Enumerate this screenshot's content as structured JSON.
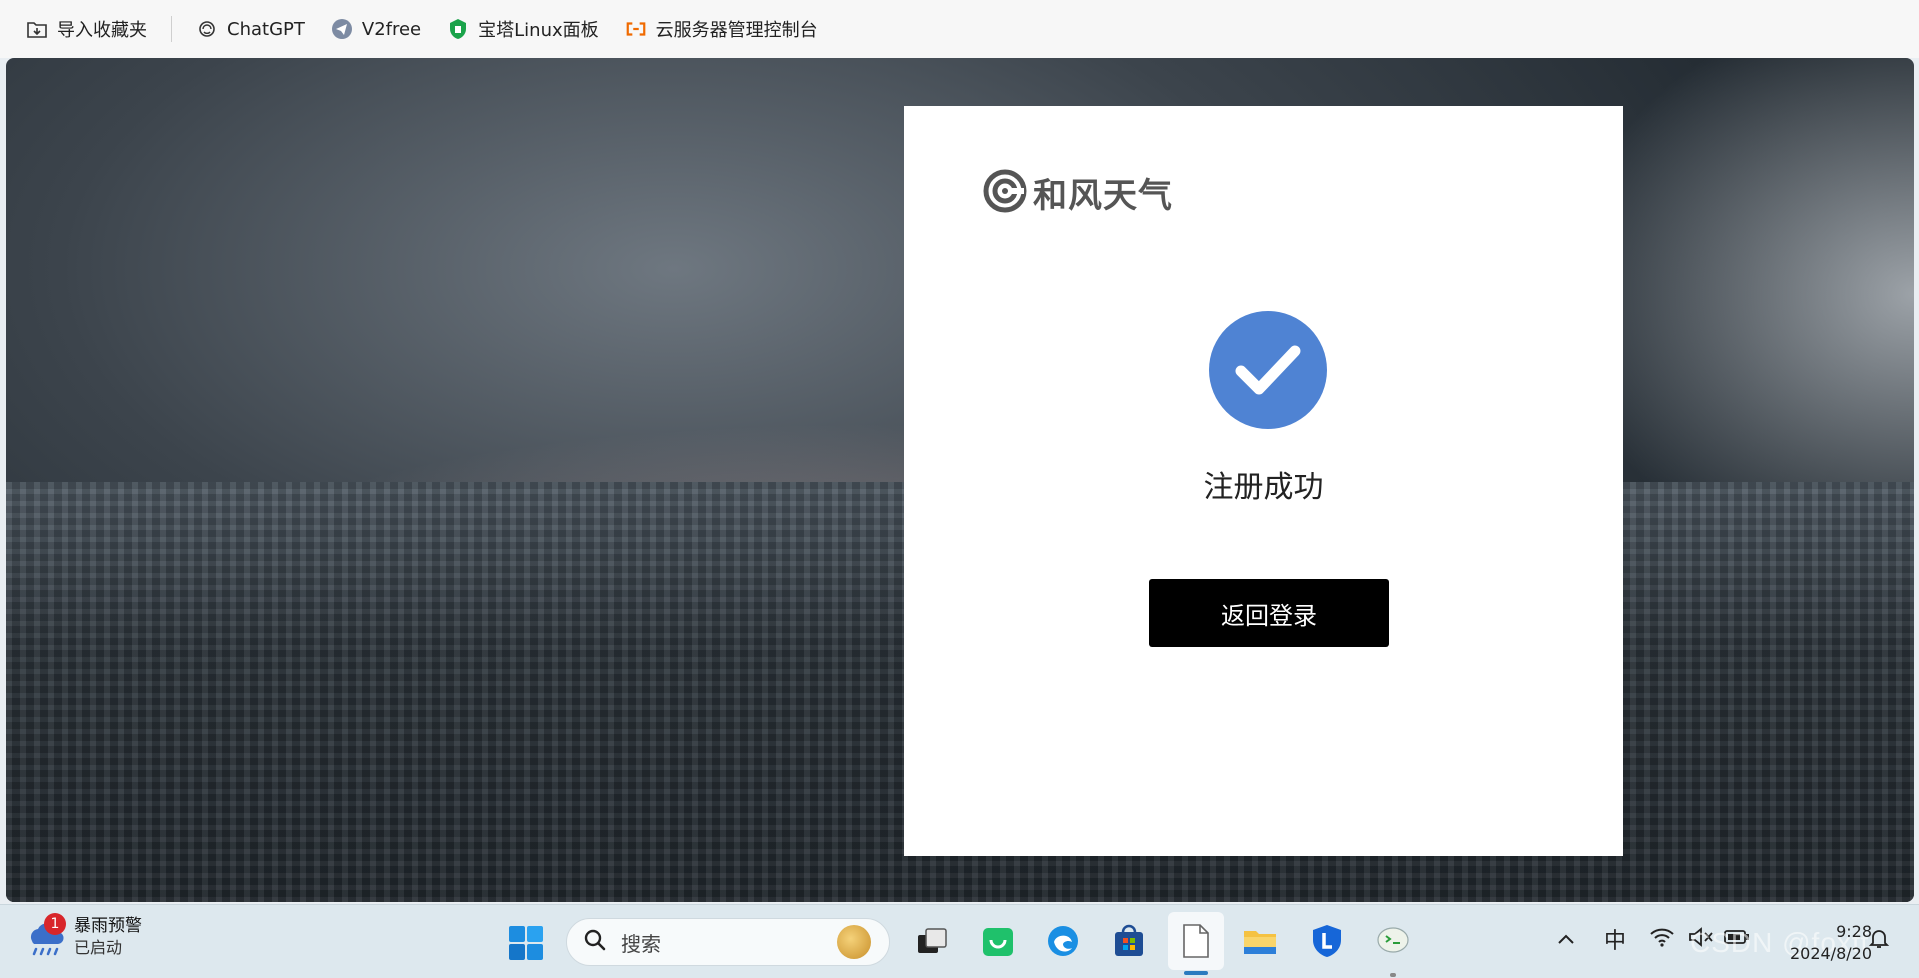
{
  "bookmarks": [
    {
      "label": "导入收藏夹",
      "icon": "import-folder-icon"
    },
    {
      "label": "ChatGPT",
      "icon": "chatgpt-icon"
    },
    {
      "label": "V2free",
      "icon": "telegram-icon"
    },
    {
      "label": "宝塔Linux面板",
      "icon": "bt-shield-icon"
    },
    {
      "label": "云服务器管理控制台",
      "icon": "aliyun-icon"
    }
  ],
  "card": {
    "brand": "和风天气",
    "success_text": "注册成功",
    "back_button": "返回登录"
  },
  "taskbar": {
    "weather_badge": "1",
    "weather_title": "暴雨预警",
    "weather_subtitle": "已启动",
    "search_placeholder": "搜索",
    "ime": "中",
    "time": "9:28",
    "date": "2024/8/20",
    "watermark": "CSDN @foxff"
  },
  "colors": {
    "accent": "#4f83d3",
    "button_bg": "#000000",
    "alert": "#d8262b"
  }
}
